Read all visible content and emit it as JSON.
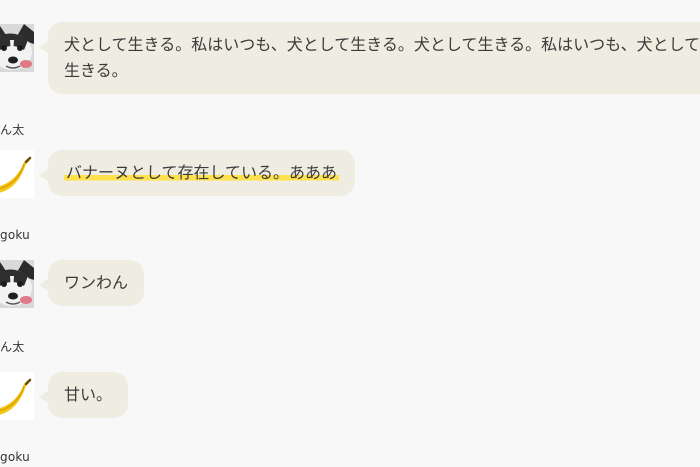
{
  "messages": [
    {
      "sender": "ん太",
      "avatar": "husky-dog-avatar",
      "text": "犬として生きる。私はいつも、犬として生きる。犬として生きる。私はいつも、犬として生きる。",
      "highlighted": false
    },
    {
      "sender": "goku",
      "avatar": "banana-avatar",
      "text": "バナーヌとして存在している。あああ",
      "highlighted": true
    },
    {
      "sender": "ん太",
      "avatar": "husky-dog-avatar",
      "text": "ワンわん",
      "highlighted": false
    },
    {
      "sender": "goku",
      "avatar": "banana-avatar",
      "text": "甘い。",
      "highlighted": false
    }
  ],
  "colors": {
    "background": "#f8f8f8",
    "bubble": "#efede1",
    "highlight": "#ffe14d",
    "text": "#3b3b3b"
  }
}
